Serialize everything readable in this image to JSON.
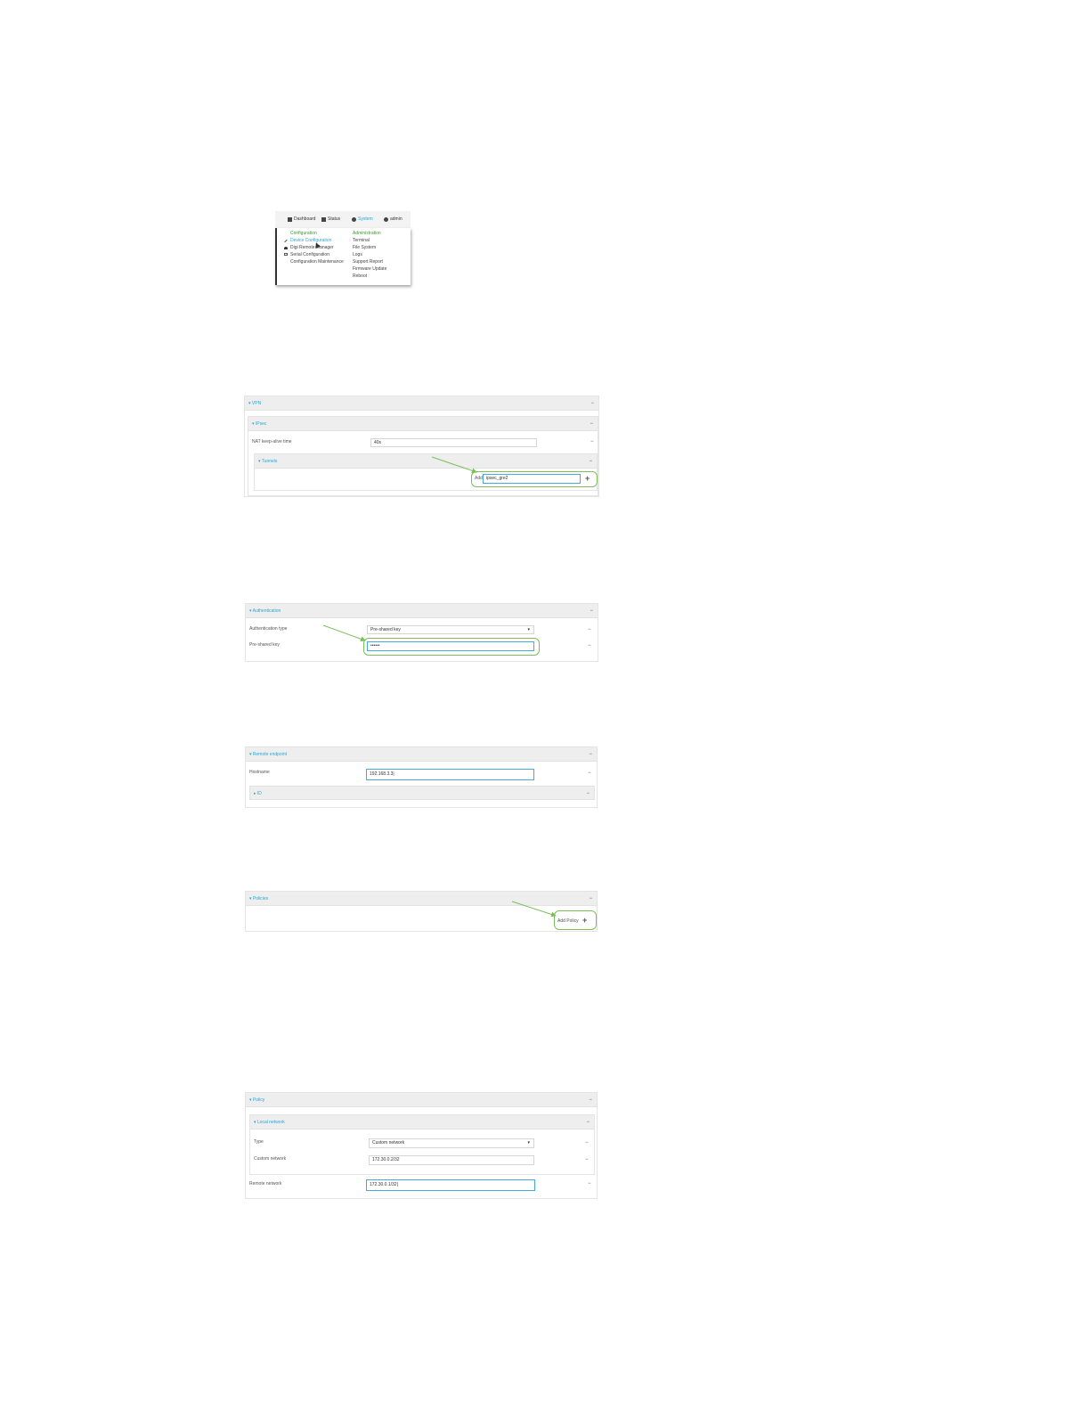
{
  "nav": {
    "items": [
      {
        "label": "Dashboard",
        "icon": "home-icon"
      },
      {
        "label": "Status",
        "icon": "grid-icon"
      },
      {
        "label": "System",
        "icon": "gear-icon"
      },
      {
        "label": "admin",
        "icon": "user-icon"
      }
    ],
    "configuration_header": "Configuration",
    "administration_header": "Administration",
    "configuration_items": [
      "Device Configuration",
      "Digi Remote Manager",
      "Serial Configuration",
      "Configuration Maintenance"
    ],
    "administration_items": [
      "Terminal",
      "File System",
      "Logs",
      "Support Report",
      "Firmware Update",
      "Reboot"
    ]
  },
  "vpn_panel": {
    "title": "VPN",
    "ipsec_title": "IPsec",
    "nat_label": "NAT keep-alive time",
    "nat_value": "40s",
    "tunnels_title": "Tunnels",
    "add_label": "Add",
    "add_value": "ipsec_gre2"
  },
  "auth_panel": {
    "title": "Authentication",
    "type_label": "Authentication type",
    "type_value": "Pre-shared key",
    "key_label": "Pre-shared key",
    "key_value": "••••••"
  },
  "remote_panel": {
    "title": "Remote endpoint",
    "hostname_label": "Hostname",
    "hostname_value": "192.168.3.3|",
    "id_title": "ID"
  },
  "policies_panel": {
    "title": "Policies",
    "add_label": "Add Policy"
  },
  "policy_panel": {
    "title": "Policy",
    "local_title": "Local network",
    "type_label": "Type",
    "type_value": "Custom network",
    "custom_label": "Custom network",
    "custom_value": "172.30.0.2/32",
    "remote_label": "Remote network",
    "remote_value": "172.30.0.1/32|"
  },
  "colors": {
    "accent": "#2aa5d8",
    "highlight": "#7cbf5a",
    "green_text": "#3a9a2f"
  }
}
